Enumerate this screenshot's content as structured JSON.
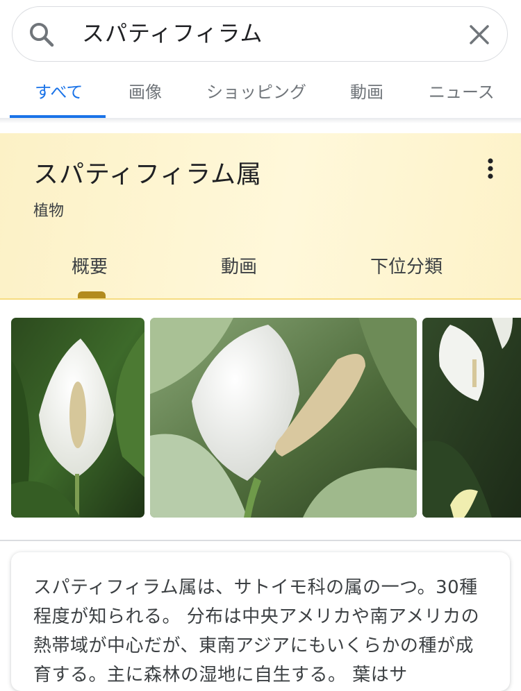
{
  "search": {
    "query": "スパティフィラム"
  },
  "tabs": [
    {
      "label": "すべて",
      "active": true
    },
    {
      "label": "画像"
    },
    {
      "label": "ショッピング"
    },
    {
      "label": "動画"
    },
    {
      "label": "ニュース"
    }
  ],
  "knowledge_panel": {
    "title": "スパティフィラム属",
    "subtitle": "植物",
    "tabs": [
      "概要",
      "動画",
      "下位分類"
    ],
    "description": "スパティフィラム属は、サトイモ科の属の一つ。30種程度が知られる。 分布は中央アメリカや南アメリカの熱帯域が中心だが、東南アジアにもいくらかの種が成育する。主に森林の湿地に自生する。 葉はサ"
  },
  "colors": {
    "accent": "#1a73e8",
    "panel_background": "#fcf1c6",
    "panel_indicator": "#b28b1e"
  },
  "icons": [
    "search-icon",
    "close-icon",
    "more-vert-icon"
  ]
}
